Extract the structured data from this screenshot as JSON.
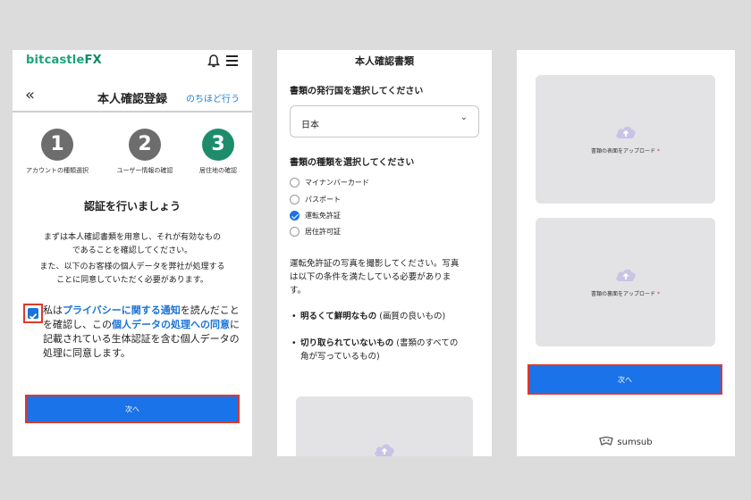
{
  "panel1": {
    "logo_main": "bitcastle",
    "logo_fx": "FX",
    "header_title": "本人確認登録",
    "later_link": "のちほど行う",
    "steps": [
      {
        "number": "1",
        "label": "アカウントの種類選択"
      },
      {
        "number": "2",
        "label": "ユーザー情報の確認"
      },
      {
        "number": "3",
        "label": "居住地の確認"
      }
    ],
    "heading": "認証を行いましょう",
    "para1_line1": "まずは本人確認書類を用意し、それが有効なもの",
    "para1_line2": "であることを確認してください。",
    "para2_line1": "また、以下のお客様の個人データを弊社が処理する",
    "para2_line2": "ことに同意していただく必要があります。",
    "consent_1": "私は",
    "consent_link1": "プライバシーに関する通知",
    "consent_2": "を読んだことを確認し、この",
    "consent_link2": "個人データの処理への同意",
    "consent_3": "に記載されている生体認証を含む個人データの処理に同意します。",
    "next_button": "次へ"
  },
  "panel2": {
    "title": "本人確認書類",
    "country_label": "書類の発行国を選択してください",
    "country_value": "日本",
    "doctype_label": "書類の種類を選択してください",
    "doc_options": [
      {
        "label": "マイナンバーカード",
        "selected": false
      },
      {
        "label": "パスポート",
        "selected": false
      },
      {
        "label": "運転免許証",
        "selected": true
      },
      {
        "label": "居住許可証",
        "selected": false
      }
    ],
    "instruction_line1": "運転免許証の写真を撮影してください。写真",
    "instruction_line2": "は以下の条件を満たしている必要がありま",
    "instruction_line3": "す。",
    "cond1_bold": "明るくて鮮明なもの",
    "cond1_rest": "(画質の良いもの)",
    "cond2_bold": "切り取られていないもの",
    "cond2_rest": "(書類のすべての",
    "cond2_line2": "角が写っているもの)"
  },
  "panel3": {
    "upload_front": "書類の表面をアップロード",
    "upload_back": "書類の裏面をアップロード",
    "required_mark": "*",
    "next_button": "次へ",
    "brand": "sumsub"
  },
  "colors": {
    "accent_blue": "#1a73e8",
    "brand_green": "#1e8c6b",
    "highlight_red": "#e0382a"
  }
}
